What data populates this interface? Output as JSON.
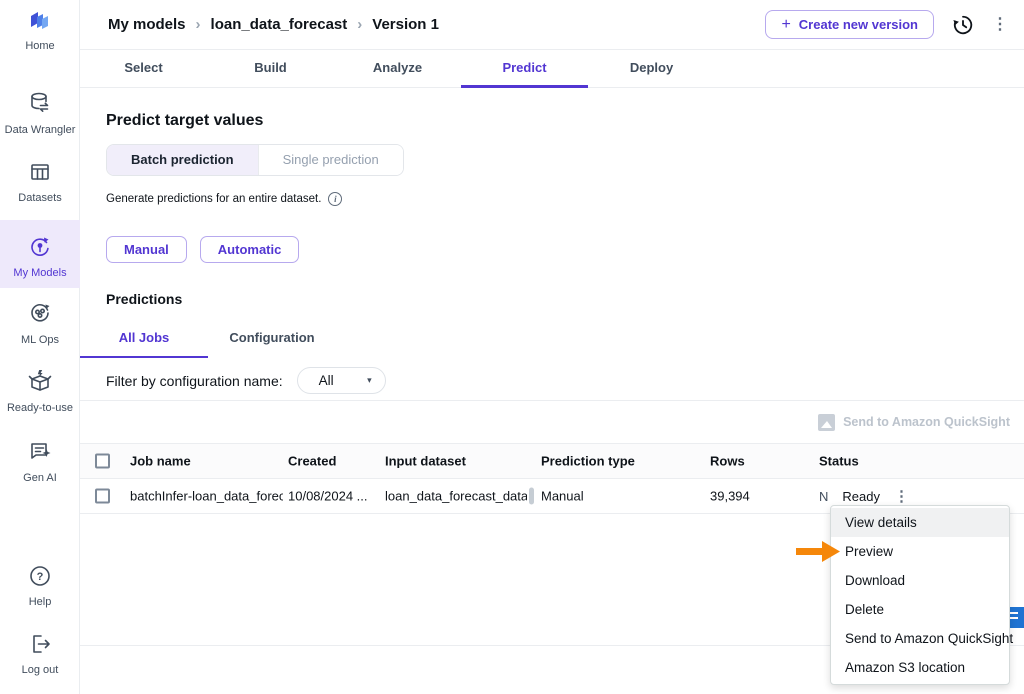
{
  "sidebar": {
    "items": [
      "Home",
      "Data Wrangler",
      "Datasets",
      "My Models",
      "ML Ops",
      "Ready-to-use",
      "Gen AI",
      "Help",
      "Log out"
    ]
  },
  "header": {
    "breadcrumb": [
      "My models",
      "loan_data_forecast",
      "Version 1"
    ],
    "create_button": "Create new version"
  },
  "model_tabs": [
    "Select",
    "Build",
    "Analyze",
    "Predict",
    "Deploy"
  ],
  "predict": {
    "title": "Predict target values",
    "modes": [
      "Batch prediction",
      "Single prediction"
    ],
    "caption": "Generate predictions for an entire dataset.",
    "manual_button": "Manual",
    "automatic_button": "Automatic"
  },
  "predictions": {
    "title": "Predictions",
    "tabs": [
      "All Jobs",
      "Configuration"
    ],
    "filter_label": "Filter by configuration name:",
    "filter_value": "All",
    "quicksight_action": "Send to Amazon QuickSight"
  },
  "table": {
    "columns": [
      "Job name",
      "Created",
      "Input dataset",
      "Prediction type",
      "Rows",
      "Status"
    ],
    "rows": [
      {
        "job_name": "batchInfer-loan_data_forecast",
        "created": "10/08/2024 ...",
        "input_dataset": "loan_data_forecast_dataset",
        "prediction_type": "Manual",
        "rows": "39,394",
        "status_prefix": "N",
        "status": "Ready"
      }
    ]
  },
  "context_menu": {
    "items": [
      "View details",
      "Preview",
      "Download",
      "Delete",
      "Send to Amazon QuickSight",
      "Amazon S3 location"
    ]
  },
  "icons": {
    "plus": "+",
    "chevron": "›",
    "caret": "▾",
    "kebab": "⋮",
    "info": "i",
    "question": "?"
  },
  "colors": {
    "accent": "#5236d2",
    "arrow_orange": "#f5870a",
    "quicksight_blue": "#1f73d2"
  }
}
